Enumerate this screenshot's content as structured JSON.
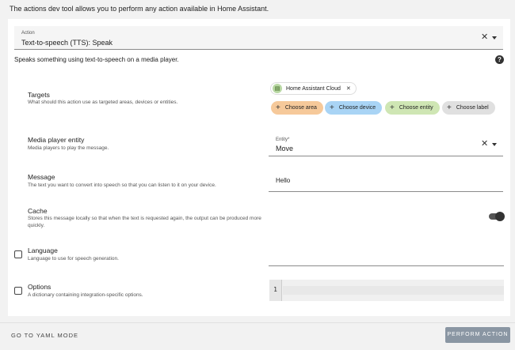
{
  "intro_text": "The actions dev tool allows you to perform any action available in Home Assistant.",
  "action_picker": {
    "label": "Action",
    "value": "Text-to-speech (TTS): Speak"
  },
  "action_description": "Speaks something using text-to-speech on a media player.",
  "targets": {
    "title": "Targets",
    "description": "What should this action use as targeted areas, devices or entities.",
    "selected": {
      "label": "Home Assistant Cloud",
      "icon": "speech-entity-icon",
      "color": "#b9d8a4"
    },
    "pickers": [
      {
        "label": "Choose area",
        "color": "#f6c99a"
      },
      {
        "label": "Choose device",
        "color": "#a9d4f5"
      },
      {
        "label": "Choose entity",
        "color": "#cfe6b4"
      },
      {
        "label": "Choose label",
        "color": "#e0e0e0"
      }
    ]
  },
  "media_player": {
    "title": "Media player entity",
    "description": "Media players to play the message.",
    "field_label": "Entity*",
    "value": "Move"
  },
  "message": {
    "title": "Message",
    "description": "The text you want to convert into speech so that you can listen to it on your device.",
    "value": "Hello"
  },
  "cache": {
    "title": "Cache",
    "description": "Stores this message locally so that when the text is requested again, the output can be produced more quickly.",
    "enabled": true
  },
  "language": {
    "title": "Language",
    "description": "Language to use for speech generation."
  },
  "options": {
    "title": "Options",
    "description": "A dictionary containing integration-specific options.",
    "line_number": "1"
  },
  "footer": {
    "yaml_mode_label": "GO TO YAML MODE",
    "perform_label": "PERFORM ACTION"
  }
}
